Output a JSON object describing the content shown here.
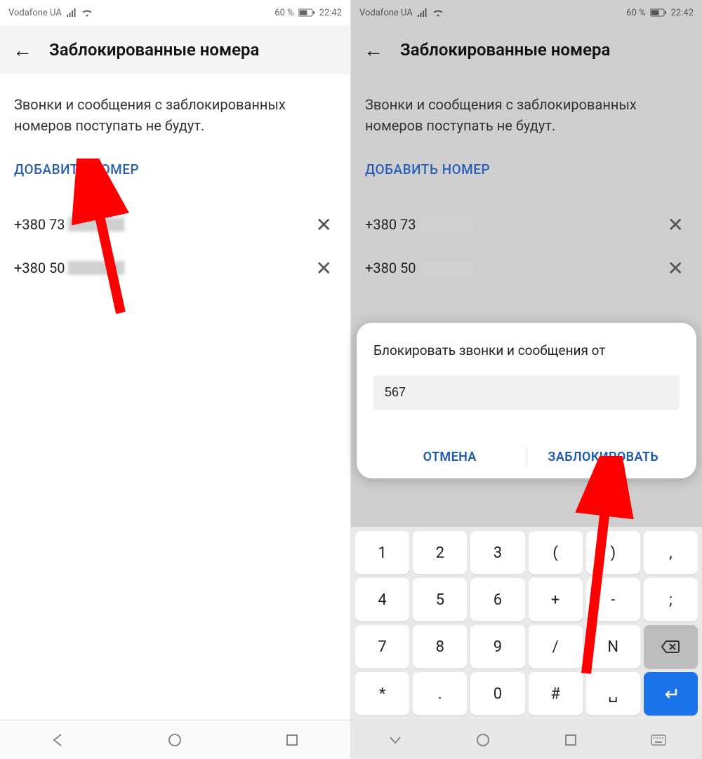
{
  "status": {
    "carrier": "Vodafone UA",
    "battery_pct": "60 %",
    "time": "22:42"
  },
  "appbar": {
    "title": "Заблокированные номера"
  },
  "body": {
    "description": "Звонки и сообщения с заблокированных номеров поступать не будут.",
    "add_link": "ДОБАВИТЬ НОМЕР"
  },
  "numbers": [
    {
      "prefix": "+380 73"
    },
    {
      "prefix": "+380 50"
    }
  ],
  "dialog": {
    "title": "Блокировать звонки и сообщения от",
    "input_value": "567",
    "cancel": "ОТМЕНА",
    "confirm": "ЗАБЛОКИРОВАТЬ"
  },
  "keyboard": {
    "rows": [
      [
        "1",
        "2",
        "3",
        "(",
        ")",
        ","
      ],
      [
        "4",
        "5",
        "6",
        "+",
        "-",
        ";"
      ],
      [
        "7",
        "8",
        "9",
        "/",
        "N",
        "⌫"
      ],
      [
        "*",
        ".",
        "0",
        "#",
        " ",
        "↵"
      ]
    ]
  }
}
